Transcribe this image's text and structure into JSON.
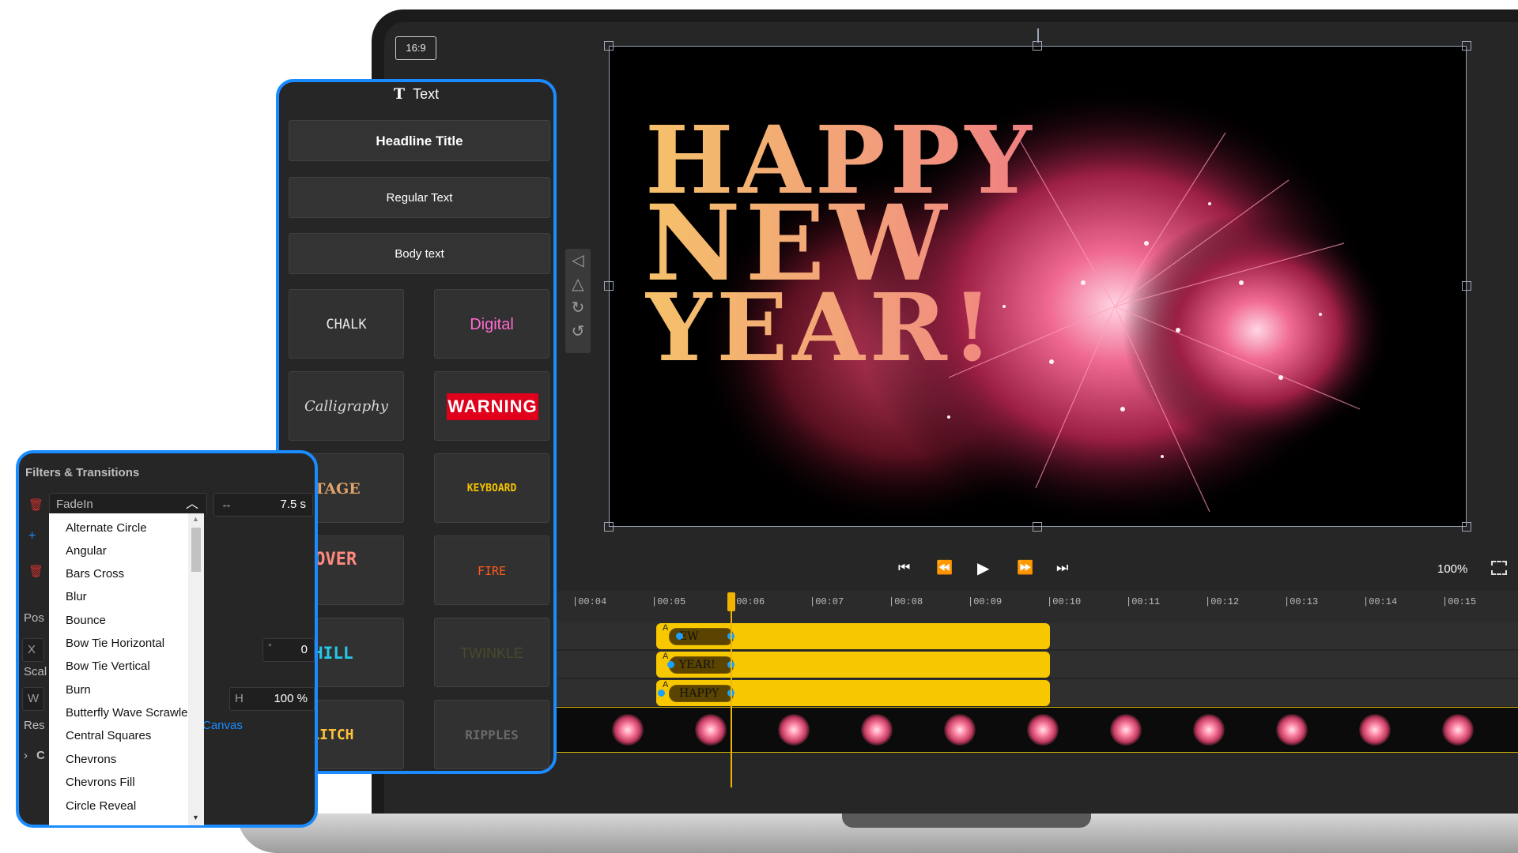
{
  "aspect_ratio": "16:9",
  "canvas": {
    "headline_lines": [
      "HAPPY",
      "NEW",
      "YEAR!"
    ]
  },
  "playback": {
    "zoom": "100%"
  },
  "timeline": {
    "ticks": [
      "00:04",
      "00:05",
      "00:06",
      "00:07",
      "00:08",
      "00:09",
      "00:10",
      "00:11",
      "00:12",
      "00:13",
      "00:14",
      "00:15"
    ],
    "clips": [
      {
        "label": "EW",
        "marker": "A"
      },
      {
        "label": "YEAR!",
        "marker": "A"
      },
      {
        "label": "HAPPY",
        "marker": "A"
      }
    ]
  },
  "text_panel": {
    "title": "Text",
    "buttons": [
      "Headline Title",
      "Regular Text",
      "Body text"
    ],
    "styles": [
      "CHALK",
      "Digital",
      "Calligraphy",
      "WARNING",
      "VINTAGE",
      "KEYBOARD",
      "GAME OVER",
      "FIRE",
      "CHILL",
      "TWINKLE",
      "GLITCH",
      "RIPPLES"
    ]
  },
  "filters_panel": {
    "title": "Filters & Transitions",
    "selected_filter": "FadeIn",
    "duration": "7.5 s",
    "rotation": "0",
    "height_label": "H",
    "height_value": "100 %",
    "width_label": "W",
    "x_label": "X",
    "position_label": "Pos",
    "scale_label": "Scal",
    "reset_label": "Res",
    "canvas_link": "Canvas",
    "collapsed_label": "C",
    "options": [
      "Alternate Circle",
      "Angular",
      "Bars Cross",
      "Blur",
      "Bounce",
      "Bow Tie Horizontal",
      "Bow Tie Vertical",
      "Burn",
      "Butterfly Wave Scrawler",
      "Central Squares",
      "Chevrons",
      "Chevrons Fill",
      "Circle Reveal"
    ]
  },
  "colors": {
    "accent": "#1a8cff",
    "clip": "#f7c800",
    "playhead": "#f0b400",
    "warning": "#e0001b"
  }
}
